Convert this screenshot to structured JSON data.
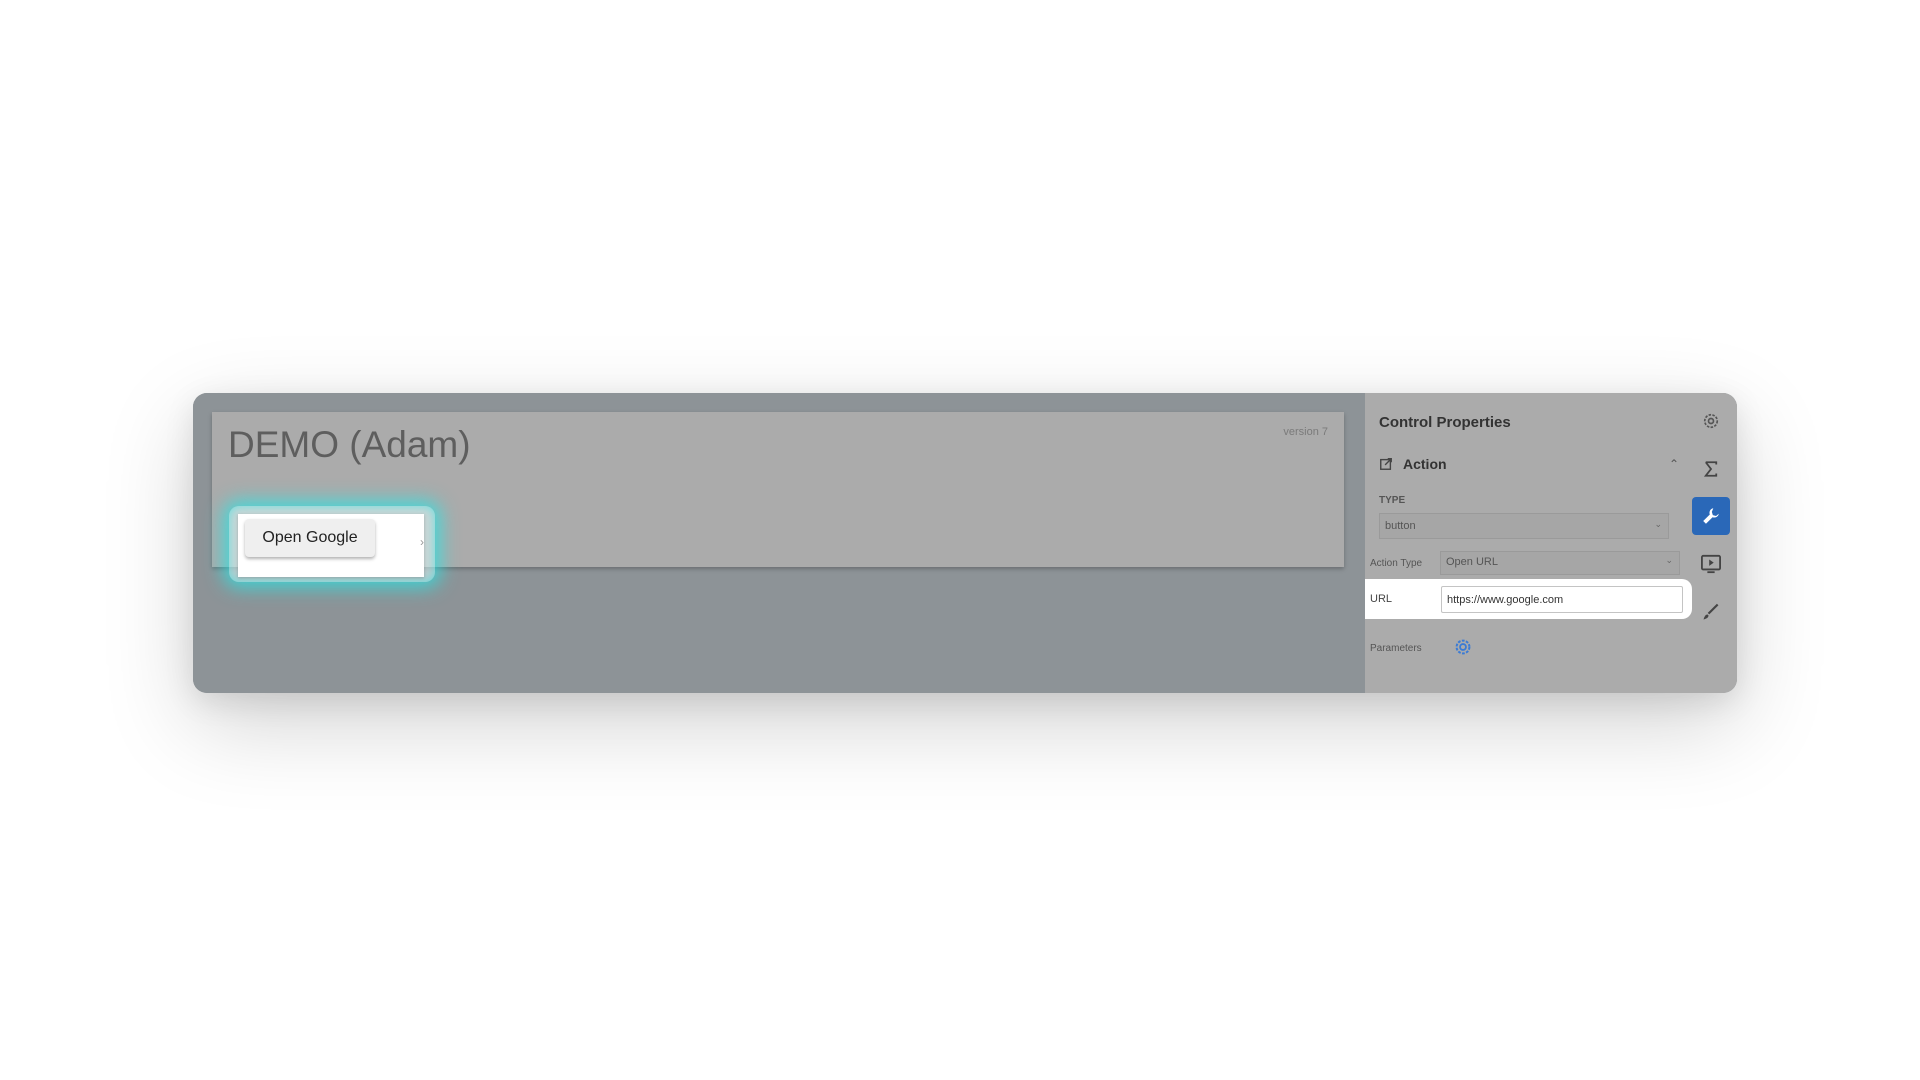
{
  "app": {
    "title": "DEMO (Adam)",
    "version": "version 7",
    "button_label": "Open Google",
    "small_arrow": "›"
  },
  "panel": {
    "title": "Control Properties",
    "section": "Action",
    "type_label": "TYPE",
    "type_value": "button",
    "action_type_label": "Action Type",
    "action_type_value": "Open URL",
    "url_label": "URL",
    "url_value": "https://www.google.com",
    "parameters_label": "Parameters"
  },
  "side_icons": [
    "gear-icon",
    "sigma-icon",
    "wrench-icon",
    "preview-icon",
    "brush-icon"
  ],
  "colors": {
    "accent": "#2a68b8",
    "highlight_glow": "#28e6e6",
    "params_gear": "#3a7bd5"
  }
}
